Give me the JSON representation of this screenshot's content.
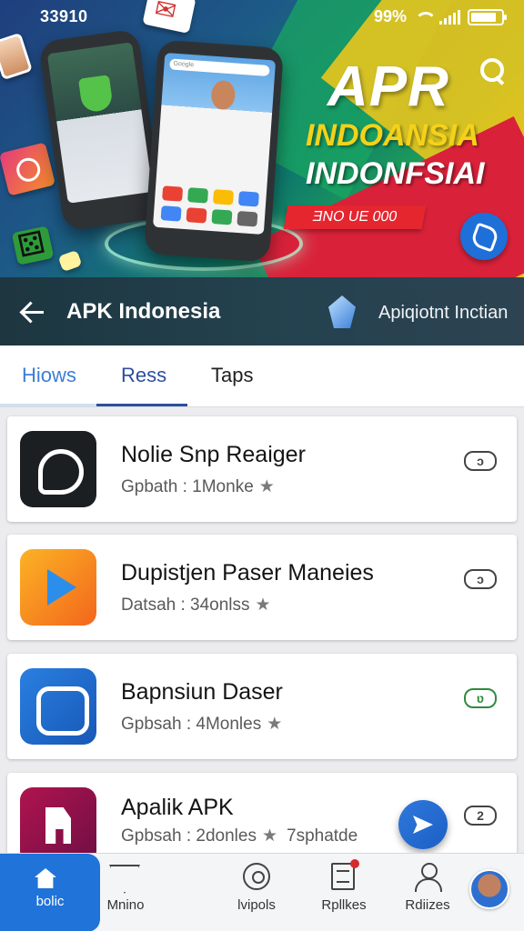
{
  "status_bar": {
    "time": "33910",
    "battery_text": "99%",
    "battery_level": 0.85
  },
  "hero": {
    "title_line1": "APR",
    "title_line2": "INDOANSIA",
    "title_line3": "INDONFSIAI",
    "cta_label": "ƎNO UE 000",
    "phone_search_text": "Google"
  },
  "app_bar": {
    "title": "APK Indonesia",
    "subtitle": "Apiqiotnt Inctian"
  },
  "tabs": [
    {
      "label": "Hiows",
      "active": false
    },
    {
      "label": "Ress",
      "active": true
    },
    {
      "label": "Taps",
      "active": false
    }
  ],
  "apps": [
    {
      "name": "Nolie Snp Reaiger",
      "meta": "Gpbath : 1Monke",
      "extra": "",
      "badge": "ɔ",
      "badge_color": "#444444",
      "icon": "chat-bubble-icon"
    },
    {
      "name": "Dupistjen Paser Maneies",
      "meta": "Datsah : 34onlss",
      "extra": "",
      "badge": "ɔ",
      "badge_color": "#444444",
      "icon": "play-icon"
    },
    {
      "name": "Bapnsiun Daser",
      "meta": "Gpbsah : 4Monles",
      "extra": "",
      "badge": "ʋ",
      "badge_color": "#2e8b3e",
      "icon": "gear-badge-icon"
    },
    {
      "name": "Apalik APK",
      "meta": "Gpbsah : 2donles",
      "extra": "7sphatde",
      "badge": "2",
      "badge_color": "#444444",
      "icon": "file-icon"
    }
  ],
  "bottom_nav": [
    {
      "label": "bolic",
      "icon": "home-icon",
      "active": true
    },
    {
      "label": "Mnino",
      "icon": "movies-icon",
      "active": false
    },
    {
      "label": "lvipols",
      "icon": "apps-icon",
      "active": false
    },
    {
      "label": "Rpllkes",
      "icon": "replies-icon",
      "active": false
    },
    {
      "label": "Rdiizes",
      "icon": "profile-icon",
      "active": false
    }
  ],
  "colors": {
    "accent": "#1f73d9",
    "appbar": "#24424f",
    "cta": "#e5262f",
    "title_yellow": "#f4d21a"
  }
}
